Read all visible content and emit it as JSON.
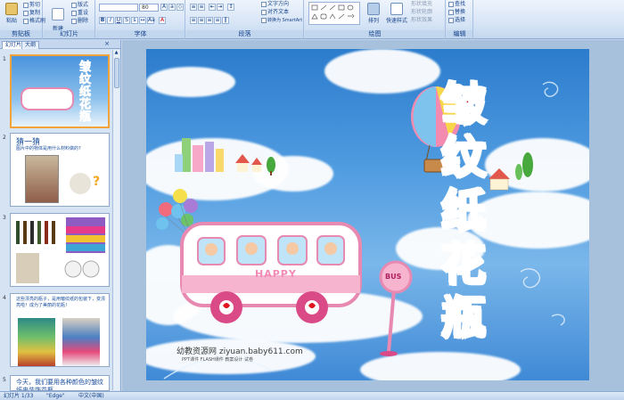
{
  "ribbon": {
    "clipboard": {
      "label": "剪贴板",
      "paste": "粘贴",
      "cut": "剪切",
      "copy": "复制",
      "format_painter": "格式刷"
    },
    "slides": {
      "label": "幻灯片",
      "new_slide": "新建\n幻灯片",
      "layout": "版式",
      "reset": "重设",
      "delete": "删除"
    },
    "font": {
      "label": "字体",
      "font_size": "80"
    },
    "paragraph": {
      "label": "段落",
      "text_direction": "文字方向",
      "align_text": "对齐文本",
      "smartart": "转换为 SmartArt"
    },
    "drawing": {
      "label": "绘图",
      "arrange": "排列",
      "quick_styles": "快速样式",
      "shape_fill": "形状填充",
      "shape_outline": "形状轮廓",
      "shape_effects": "形状效果"
    },
    "editing": {
      "label": "编辑",
      "find": "查找",
      "replace": "替换",
      "select": "选择"
    }
  },
  "left_pane": {
    "tabs": [
      "幻灯片",
      "大纲"
    ],
    "thumbnails": [
      {
        "num": "1",
        "text": ""
      },
      {
        "num": "2",
        "title": "猜一猜",
        "text": "图片中的物体是用什么材料做的?"
      },
      {
        "num": "3",
        "text": ""
      },
      {
        "num": "4",
        "text": "这些漂亮的瓶子，是用皱纹纸的包装下，变漂亮啦！成为了美丽的花瓶！"
      },
      {
        "num": "5",
        "text": "今天，我们要用各种颜色的皱纹纸来装饰花瓶"
      }
    ]
  },
  "slide": {
    "title_chars": [
      "皱",
      "纹",
      "纸",
      "花",
      "瓶"
    ],
    "bus_word": "HAPPY",
    "sign_word": "BUS",
    "watermark": "幼教资源网 ziyuan.baby611.com",
    "watermark_sub": "PPT课件  FLASH课件  教案设计  试卷"
  },
  "status": {
    "slide_count": "幻灯片 1/33",
    "theme": "\"Edge\"",
    "lang": "中文(中国)"
  },
  "colors": {
    "title_red": "#e0141c",
    "ribbon_blue": "#15428b",
    "selection": "#f2a33a"
  }
}
